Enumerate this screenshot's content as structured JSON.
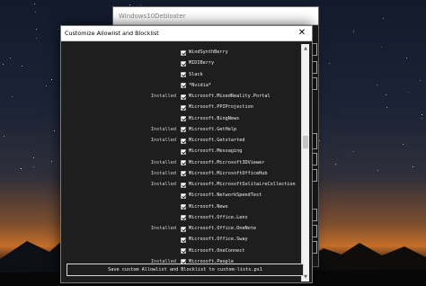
{
  "background_window": {
    "title": "Windows10Debloater"
  },
  "dialog": {
    "title": "Customize Allowlist and Blocklist",
    "close_glyph": "✕",
    "save_label": "Save custom Allowlist and Blocklist to custom-lists.ps1"
  },
  "items": [
    {
      "status": "",
      "name": "WindSynthBerry",
      "checked": true
    },
    {
      "status": "",
      "name": "MIDIBerry",
      "checked": true
    },
    {
      "status": "",
      "name": "Slack",
      "checked": true
    },
    {
      "status": "",
      "name": "*Nvidia*",
      "checked": true
    },
    {
      "status": "Installed",
      "name": "Microsoft.MixedReality.Portal",
      "checked": true
    },
    {
      "status": "",
      "name": "Microsoft.PPIProjection",
      "checked": true
    },
    {
      "status": "",
      "name": "Microsoft.BingNews",
      "checked": true
    },
    {
      "status": "Installed",
      "name": "Microsoft.GetHelp",
      "checked": true
    },
    {
      "status": "Installed",
      "name": "Microsoft.Getstarted",
      "checked": true
    },
    {
      "status": "",
      "name": "Microsoft.Messaging",
      "checked": true
    },
    {
      "status": "Installed",
      "name": "Microsoft.Microsoft3DViewer",
      "checked": true
    },
    {
      "status": "Installed",
      "name": "Microsoft.MicrosoftOfficeHub",
      "checked": true
    },
    {
      "status": "Installed",
      "name": "Microsoft.MicrosoftSolitaireCollection",
      "checked": true
    },
    {
      "status": "",
      "name": "Microsoft.NetworkSpeedTest",
      "checked": true
    },
    {
      "status": "",
      "name": "Microsoft.News",
      "checked": true
    },
    {
      "status": "",
      "name": "Microsoft.Office.Lens",
      "checked": true
    },
    {
      "status": "Installed",
      "name": "Microsoft.Office.OneNote",
      "checked": true
    },
    {
      "status": "",
      "name": "Microsoft.Office.Sway",
      "checked": true
    },
    {
      "status": "",
      "name": "Microsoft.OneConnect",
      "checked": true
    },
    {
      "status": "Installed",
      "name": "Microsoft.People",
      "checked": true
    }
  ],
  "scrollbar": {
    "up_glyph": "▲",
    "down_glyph": "▼"
  },
  "colors": {
    "dialog_bg": "#1e1e1e",
    "titlebar_bg": "#ffffff",
    "text": "#f0f0f0"
  }
}
